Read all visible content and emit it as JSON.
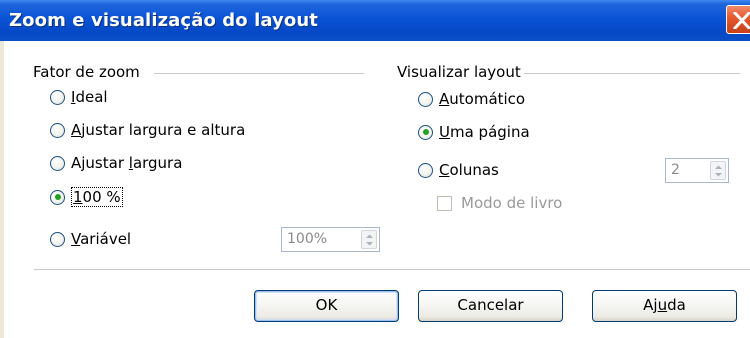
{
  "window": {
    "title": "Zoom e visualização do layout",
    "close_icon": "close-icon"
  },
  "zoom_group": {
    "title": "Fator de zoom",
    "options": [
      {
        "label": "Ideal",
        "accel": "I",
        "rest": "deal",
        "selected": false
      },
      {
        "label": "Ajustar largura e altura",
        "accel": "A",
        "rest": "justar largura e altura",
        "selected": false
      },
      {
        "label": "Ajustar largura",
        "pre": "Ajustar ",
        "accel": "l",
        "rest": "argura",
        "selected": false
      },
      {
        "label": "100 %",
        "accel": "1",
        "rest": "00 %",
        "selected": true
      },
      {
        "label": "Variável",
        "accel": "V",
        "rest": "ariável",
        "selected": false
      }
    ],
    "variable_value": "100%"
  },
  "layout_group": {
    "title": "Visualizar layout",
    "options": [
      {
        "label": "Automático",
        "accel": "A",
        "rest": "utomático",
        "selected": false
      },
      {
        "label": "Uma página",
        "accel": "U",
        "rest": "ma página",
        "selected": true
      },
      {
        "label": "Colunas",
        "accel": "C",
        "rest": "olunas",
        "selected": false
      }
    ],
    "columns_value": "2",
    "book_mode": {
      "label": "Modo de livro",
      "checked": false,
      "enabled": false
    }
  },
  "buttons": {
    "ok": "OK",
    "cancel": "Cancelar",
    "help_pre": "Aj",
    "help_accel": "u",
    "help_rest": "da"
  },
  "colors": {
    "titlebar": "#0a53d6",
    "radio_dot": "#21a121",
    "button_border": "#003c74"
  }
}
